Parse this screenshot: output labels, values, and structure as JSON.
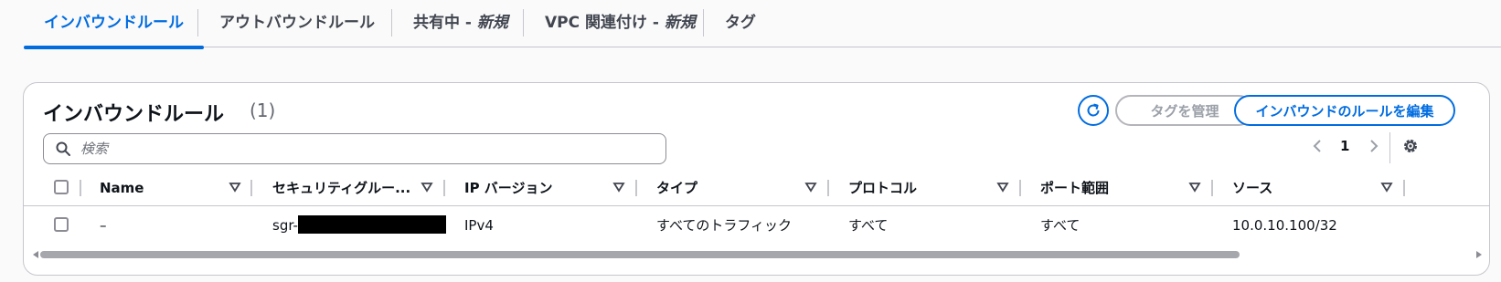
{
  "tabs": [
    {
      "label": "インバウンドルール",
      "suffix": ""
    },
    {
      "label": "アウトバウンドルール",
      "suffix": ""
    },
    {
      "label": "共有中 - ",
      "suffix": "新規"
    },
    {
      "label": "VPC 関連付け - ",
      "suffix": "新規"
    },
    {
      "label": "タグ",
      "suffix": ""
    }
  ],
  "active_tab": "インバウンドルール",
  "panel": {
    "title": "インバウンドルール",
    "count": "(1)",
    "manage_tags_label": "タグを管理",
    "edit_rules_label": "インバウンドのルールを編集"
  },
  "search": {
    "placeholder": "検索",
    "value": ""
  },
  "pagination": {
    "current_page": "1"
  },
  "table": {
    "columns": [
      "Name",
      "セキュリティグルー...",
      "IP バージョン",
      "タイプ",
      "プロトコル",
      "ポート範囲",
      "ソース"
    ],
    "rows": [
      {
        "name": "–",
        "security_group_rule_id": "sgr-",
        "ip_version": "IPv4",
        "type": "すべてのトラフィック",
        "protocol": "すべて",
        "port_range": "すべて",
        "source": "10.0.10.100/32"
      }
    ]
  },
  "colors": {
    "accent": "#006ce0",
    "border": "#c6c6cd",
    "disabled": "#9ba0a8"
  },
  "icons": [
    "refresh-icon",
    "search-icon",
    "chevron-left-icon",
    "chevron-right-icon",
    "gear-icon",
    "sort-icon"
  ]
}
